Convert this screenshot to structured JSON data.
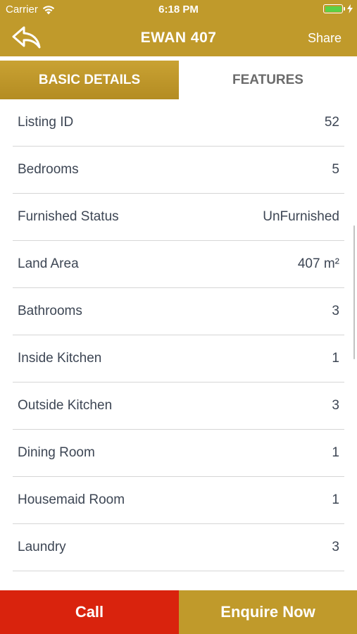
{
  "status_bar": {
    "carrier": "Carrier",
    "time": "6:18 PM"
  },
  "nav": {
    "title": "EWAN 407",
    "share_label": "Share"
  },
  "tabs": [
    {
      "label": "BASIC DETAILS",
      "active": true
    },
    {
      "label": "FEATURES",
      "active": false
    }
  ],
  "details": [
    {
      "label": "Listing ID",
      "value": "52"
    },
    {
      "label": "Bedrooms",
      "value": "5"
    },
    {
      "label": "Furnished Status",
      "value": "UnFurnished"
    },
    {
      "label": "Land Area",
      "value": "407 m²"
    },
    {
      "label": "Bathrooms",
      "value": "3"
    },
    {
      "label": "Inside Kitchen",
      "value": "1"
    },
    {
      "label": "Outside Kitchen",
      "value": "3"
    },
    {
      "label": "Dining Room",
      "value": "1"
    },
    {
      "label": "Housemaid Room",
      "value": "1"
    },
    {
      "label": "Laundry",
      "value": "3"
    }
  ],
  "actions": {
    "call_label": "Call",
    "enquire_label": "Enquire Now"
  },
  "colors": {
    "brand_gold": "#c09a2b",
    "call_red": "#d9230d",
    "text": "#3d4654",
    "battery_green": "#5ad146"
  },
  "icons": {
    "back": "back-arrow-icon",
    "wifi": "wifi-icon",
    "battery": "battery-icon",
    "charging": "charging-bolt-icon"
  }
}
